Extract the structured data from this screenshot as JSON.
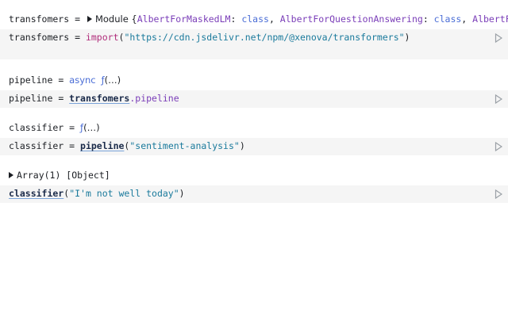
{
  "cells": [
    {
      "output": {
        "name": "transfomers",
        "eq": " = ",
        "text": "Module {",
        "entries": [
          "AlbertForMaskedLM",
          ": ",
          "class",
          ", ",
          "AlbertForQuestionAnswering",
          ": ",
          "class",
          ", ",
          "AlbertForSeq"
        ]
      },
      "code": {
        "name": "transfomers",
        "eq": " = ",
        "fn": "import",
        "open": "(",
        "arg": "\"https://cdn.jsdelivr.net/npm/@xenova/transformers\"",
        "close": ")"
      }
    },
    {
      "output": {
        "name": "pipeline",
        "eq": " = ",
        "kw": "async",
        "fn": "ƒ",
        "rest": "(…)"
      },
      "code": {
        "name": "pipeline",
        "eq": " = ",
        "ref": "transfomers",
        "prop": ".pipeline"
      }
    },
    {
      "output": {
        "name": "classifier",
        "eq": " = ",
        "fn": "ƒ",
        "rest": "(…)"
      },
      "code": {
        "name": "classifier",
        "eq": " = ",
        "ref": "pipeline",
        "open": "(",
        "arg": "\"sentiment-analysis\"",
        "close": ")"
      }
    },
    {
      "output": {
        "text": "Array(1) [Object]"
      },
      "code": {
        "ref": "classifier",
        "open": "(",
        "arg": "\"I'm not well today\"",
        "close": ")"
      }
    }
  ],
  "icons": {
    "run": "play-icon",
    "expand": "disclosure-triangle-icon"
  },
  "colors": {
    "cell_bg": "#f5f5f5",
    "keyword": "#4a6dd6",
    "function": "#b02c7a",
    "string": "#1a7a9c",
    "property": "#7a3db8"
  }
}
